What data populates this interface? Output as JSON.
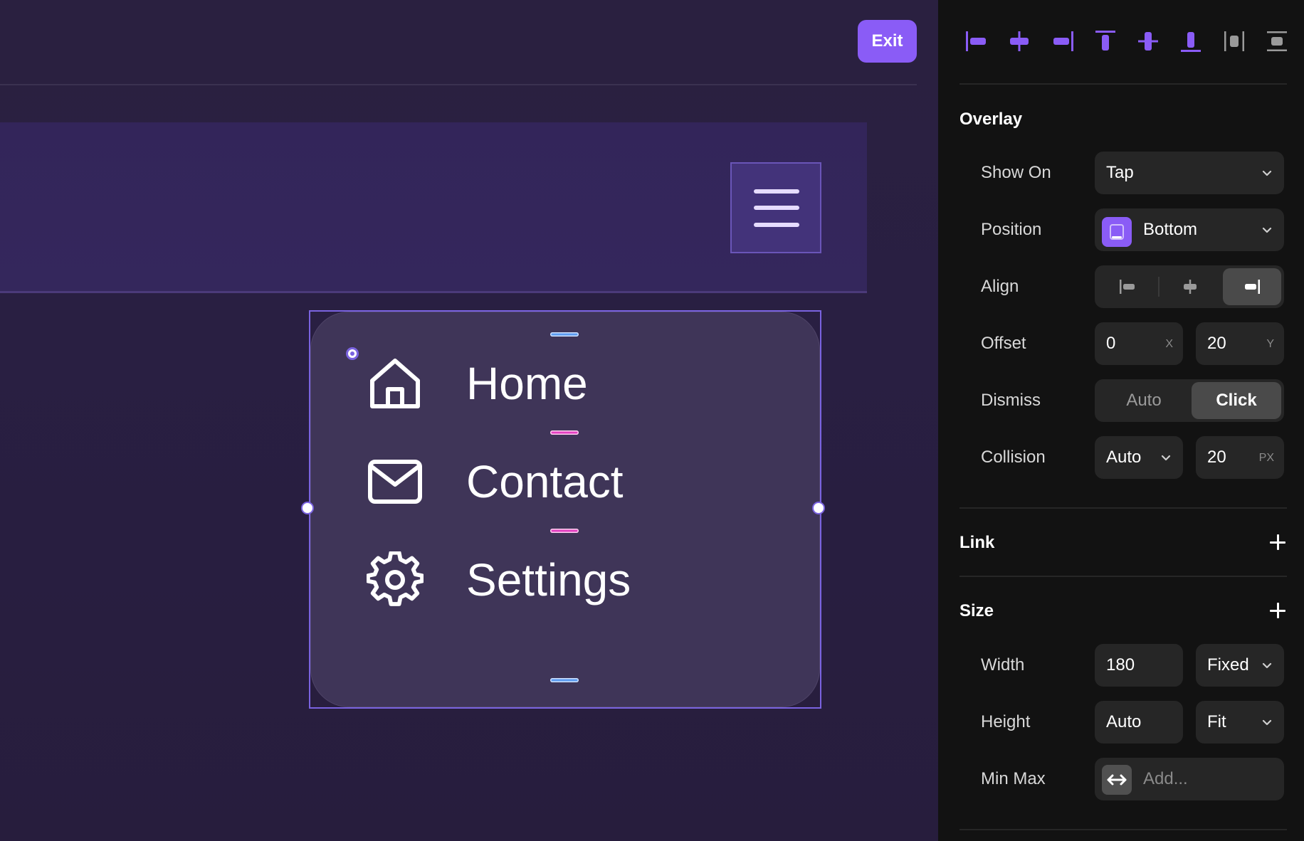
{
  "canvas": {
    "exit_label": "Exit",
    "menu": [
      {
        "label": "Home",
        "icon": "home-icon"
      },
      {
        "label": "Contact",
        "icon": "mail-icon"
      },
      {
        "label": "Settings",
        "icon": "gear-icon"
      }
    ]
  },
  "toolbar": {
    "align_icons": [
      "align-left-icon",
      "align-center-horizontal-icon",
      "align-right-icon",
      "align-top-icon",
      "align-center-vertical-icon",
      "align-bottom-icon",
      "distribute-horizontal-icon",
      "distribute-vertical-icon"
    ]
  },
  "overlay": {
    "title": "Overlay",
    "show_on": {
      "label": "Show On",
      "value": "Tap"
    },
    "position": {
      "label": "Position",
      "value": "Bottom"
    },
    "align": {
      "label": "Align",
      "selected": "right"
    },
    "offset": {
      "label": "Offset",
      "x": "0",
      "x_unit": "X",
      "y": "20",
      "y_unit": "Y"
    },
    "dismiss": {
      "label": "Dismiss",
      "options": [
        "Auto",
        "Click"
      ],
      "selected": "Click"
    },
    "collision": {
      "label": "Collision",
      "value": "Auto",
      "amount": "20",
      "unit": "PX"
    }
  },
  "link": {
    "title": "Link"
  },
  "size": {
    "title": "Size",
    "width": {
      "label": "Width",
      "value": "180",
      "mode": "Fixed"
    },
    "height": {
      "label": "Height",
      "value": "Auto",
      "mode": "Fit"
    },
    "minmax": {
      "label": "Min Max",
      "placeholder": "Add..."
    }
  },
  "colors": {
    "accent": "#8a5cf6",
    "panel_bg": "#121212",
    "canvas_bg": "#281f3e",
    "card_bg": "#3f3558"
  }
}
